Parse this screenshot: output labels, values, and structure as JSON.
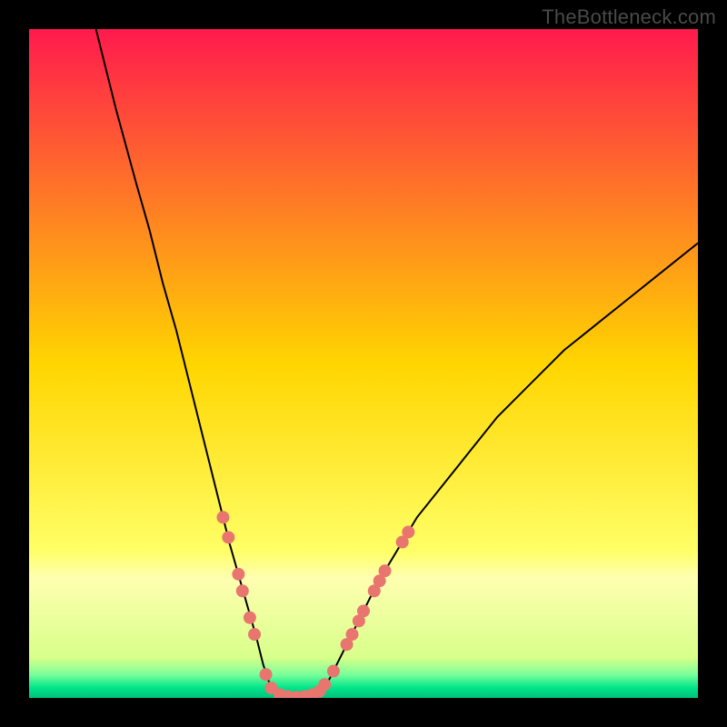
{
  "watermark": "TheBottleneck.com",
  "chart_data": {
    "type": "line",
    "title": "",
    "xlabel": "",
    "ylabel": "",
    "xlim": [
      0,
      100
    ],
    "ylim": [
      0,
      100
    ],
    "background_gradient": {
      "stops": [
        {
          "offset": 0.0,
          "color": "#ff1a4d"
        },
        {
          "offset": 0.5,
          "color": "#ffd500"
        },
        {
          "offset": 0.78,
          "color": "#ffff66"
        },
        {
          "offset": 0.82,
          "color": "#ffffb0"
        },
        {
          "offset": 0.94,
          "color": "#d8ff8a"
        },
        {
          "offset": 0.965,
          "color": "#7aff9a"
        },
        {
          "offset": 0.985,
          "color": "#00e58a"
        },
        {
          "offset": 1.0,
          "color": "#00c07a"
        }
      ]
    },
    "series": [
      {
        "name": "curve",
        "color": "#000000",
        "points": [
          {
            "x": 10,
            "y": 100
          },
          {
            "x": 13,
            "y": 88
          },
          {
            "x": 16,
            "y": 77
          },
          {
            "x": 18,
            "y": 70
          },
          {
            "x": 20,
            "y": 62
          },
          {
            "x": 22,
            "y": 55
          },
          {
            "x": 24,
            "y": 47
          },
          {
            "x": 26,
            "y": 39
          },
          {
            "x": 28,
            "y": 31
          },
          {
            "x": 30,
            "y": 23
          },
          {
            "x": 32,
            "y": 16
          },
          {
            "x": 34,
            "y": 9
          },
          {
            "x": 35,
            "y": 5
          },
          {
            "x": 36,
            "y": 2
          },
          {
            "x": 37,
            "y": 0.8
          },
          {
            "x": 38,
            "y": 0.3
          },
          {
            "x": 39,
            "y": 0.1
          },
          {
            "x": 40,
            "y": 0.1
          },
          {
            "x": 41,
            "y": 0.1
          },
          {
            "x": 42,
            "y": 0.1
          },
          {
            "x": 43,
            "y": 0.3
          },
          {
            "x": 44,
            "y": 1.2
          },
          {
            "x": 45,
            "y": 3
          },
          {
            "x": 46,
            "y": 5
          },
          {
            "x": 48,
            "y": 9
          },
          {
            "x": 50,
            "y": 13
          },
          {
            "x": 52,
            "y": 17
          },
          {
            "x": 55,
            "y": 22
          },
          {
            "x": 58,
            "y": 27
          },
          {
            "x": 62,
            "y": 32
          },
          {
            "x": 66,
            "y": 37
          },
          {
            "x": 70,
            "y": 42
          },
          {
            "x": 75,
            "y": 47
          },
          {
            "x": 80,
            "y": 52
          },
          {
            "x": 85,
            "y": 56
          },
          {
            "x": 90,
            "y": 60
          },
          {
            "x": 95,
            "y": 64
          },
          {
            "x": 100,
            "y": 68
          }
        ]
      }
    ],
    "markers": {
      "name": "highlight-dots",
      "color": "#e8766f",
      "radius": 7,
      "points": [
        {
          "x": 29.0,
          "y": 27.0
        },
        {
          "x": 29.8,
          "y": 24.0
        },
        {
          "x": 31.3,
          "y": 18.5
        },
        {
          "x": 31.9,
          "y": 16.0
        },
        {
          "x": 33.0,
          "y": 12.0
        },
        {
          "x": 33.7,
          "y": 9.5
        },
        {
          "x": 35.4,
          "y": 3.5
        },
        {
          "x": 36.2,
          "y": 1.5
        },
        {
          "x": 37.5,
          "y": 0.5
        },
        {
          "x": 38.7,
          "y": 0.2
        },
        {
          "x": 40.0,
          "y": 0.1
        },
        {
          "x": 41.2,
          "y": 0.2
        },
        {
          "x": 42.4,
          "y": 0.5
        },
        {
          "x": 43.4,
          "y": 1.0
        },
        {
          "x": 44.2,
          "y": 2.0
        },
        {
          "x": 45.5,
          "y": 4.0
        },
        {
          "x": 47.5,
          "y": 8.0
        },
        {
          "x": 48.3,
          "y": 9.5
        },
        {
          "x": 49.3,
          "y": 11.5
        },
        {
          "x": 50.0,
          "y": 13.0
        },
        {
          "x": 51.6,
          "y": 16.0
        },
        {
          "x": 52.4,
          "y": 17.5
        },
        {
          "x": 53.2,
          "y": 19.0
        },
        {
          "x": 55.8,
          "y": 23.3
        },
        {
          "x": 56.7,
          "y": 24.8
        }
      ]
    }
  }
}
